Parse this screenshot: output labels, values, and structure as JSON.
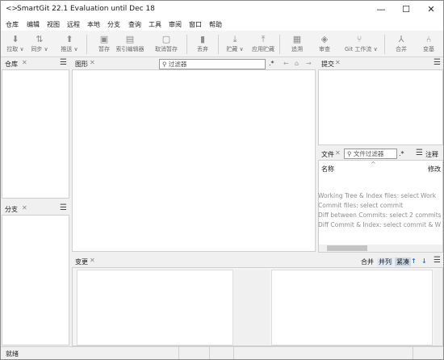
{
  "window": {
    "title": "SmartGit 22.1 Evaluation until Dec 18",
    "app_icon": "<>",
    "minimize": "—",
    "maximize": "☐",
    "close": "✕"
  },
  "menu": [
    "仓库",
    "编辑",
    "视图",
    "远程",
    "本地",
    "分支",
    "查询",
    "工具",
    "审阅",
    "窗口",
    "帮助"
  ],
  "toolbar": [
    {
      "label": "拉取 ∨",
      "icon": "pull-icon"
    },
    {
      "label": "同步 ∨",
      "icon": "sync-icon"
    },
    {
      "label": "推送 ∨",
      "icon": "push-icon"
    },
    {
      "label": "暂存",
      "icon": "stage-icon"
    },
    {
      "label": "索引编辑器",
      "icon": "index-editor-icon"
    },
    {
      "label": "取消暂存",
      "icon": "unstage-icon"
    },
    {
      "label": "丢弃",
      "icon": "discard-icon"
    },
    {
      "label": "贮藏 ∨",
      "icon": "stash-icon"
    },
    {
      "label": "应用贮藏",
      "icon": "apply-stash-icon"
    },
    {
      "label": "追溯",
      "icon": "blame-icon"
    },
    {
      "label": "审查",
      "icon": "review-icon"
    },
    {
      "label": "Git 工作流 ∨",
      "icon": "git-flow-icon"
    },
    {
      "label": "合并",
      "icon": "merge-icon"
    },
    {
      "label": "变基",
      "icon": "rebase-icon"
    }
  ],
  "panels": {
    "repositories": {
      "title": "仓库"
    },
    "branches": {
      "title": "分支"
    },
    "graph": {
      "title": "图形",
      "filter_placeholder": "过滤器",
      "regex_label": ".*"
    },
    "commit": {
      "title": "提交"
    },
    "files": {
      "title": "文件",
      "filter_placeholder": "文件过滤器",
      "regex_label": ".*",
      "col_name": "名称",
      "notes_title": "注释",
      "notes_col": "修改"
    },
    "changes": {
      "title": "变更",
      "merge_label": "合并",
      "side_by_side_label": "并列",
      "compact_label": "紧凑"
    }
  },
  "file_info_lines": [
    "Working Tree & Index files: select Work",
    "Commit files: select commit",
    "Diff between Commits: select 2 commits",
    "Diff Commit & Index: select commit & W"
  ],
  "status": {
    "text": "就绪"
  }
}
